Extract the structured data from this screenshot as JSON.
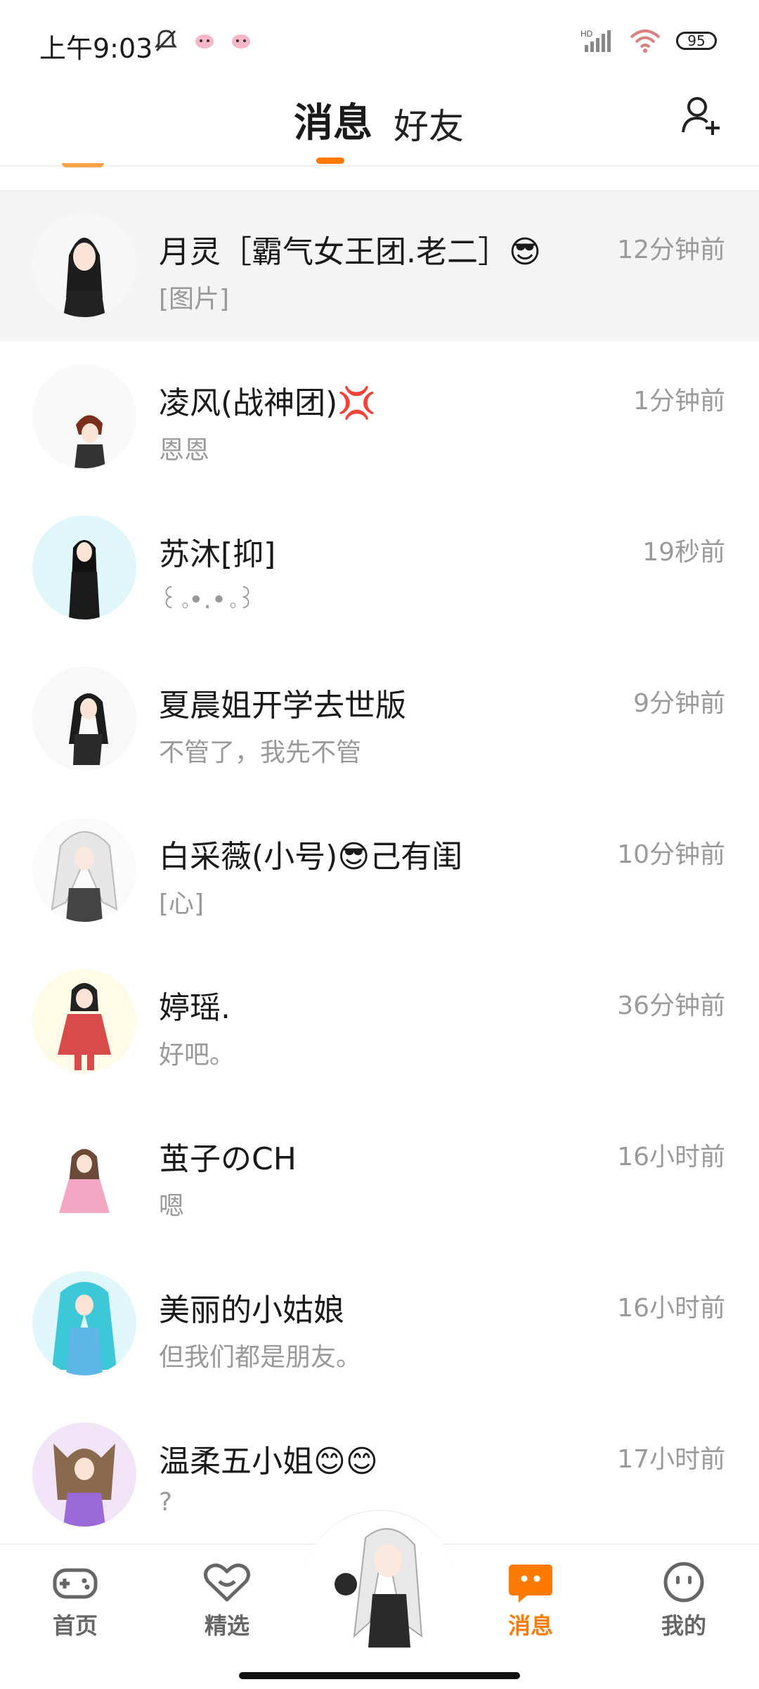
{
  "status_bar": {
    "time": "上午9:03",
    "network_label": "HD",
    "battery": "95"
  },
  "header": {
    "tabs": [
      "消息",
      "好友"
    ],
    "active_tab": "消息"
  },
  "colors": {
    "accent": "#ff7a00",
    "highlight_row": "#f4f4f4",
    "secondary_text": "#999999"
  },
  "messages": [
    {
      "name": "月灵［霸气女王团.老二］😎",
      "preview": "[图片]",
      "time": "12分钟前",
      "avatar_icon": "avatar-girl-black-hair"
    },
    {
      "name": "凌风(战神团)💢",
      "preview": "恩恩",
      "time": "1分钟前",
      "avatar_icon": "avatar-boy-brown-hair"
    },
    {
      "name": "苏沐[抑]",
      "preview": "꒰｡•.•｡꒱",
      "time": "19秒前",
      "avatar_icon": "avatar-girl-black-outfit"
    },
    {
      "name": "夏晨姐开学去世版",
      "preview": "不管了，我先不管",
      "time": "9分钟前",
      "avatar_icon": "avatar-girl-twintail"
    },
    {
      "name": "白采薇(小号)😎己有闺",
      "preview": "[心]",
      "time": "10分钟前",
      "avatar_icon": "avatar-girl-white-hair"
    },
    {
      "name": "婷瑶.",
      "preview": "好吧。",
      "time": "36分钟前",
      "avatar_icon": "avatar-girl-red-dress"
    },
    {
      "name": "茧子のCH",
      "preview": "嗯",
      "time": "16小时前",
      "avatar_icon": "avatar-girl-pink-dress"
    },
    {
      "name": "美丽的小姑娘",
      "preview": "但我们都是朋友。",
      "time": "16小时前",
      "avatar_icon": "avatar-girl-cyan-hair"
    },
    {
      "name": "温柔五小姐😊😊",
      "preview": "?",
      "time": "17小时前",
      "avatar_icon": "avatar-girl-purple"
    }
  ],
  "bottom_nav": {
    "items": [
      {
        "label": "首页",
        "icon": "gamepad-icon"
      },
      {
        "label": "精选",
        "icon": "heart-icon"
      },
      {
        "label": "消息",
        "icon": "message-icon"
      },
      {
        "label": "我的",
        "icon": "face-icon"
      }
    ],
    "active": "消息"
  }
}
